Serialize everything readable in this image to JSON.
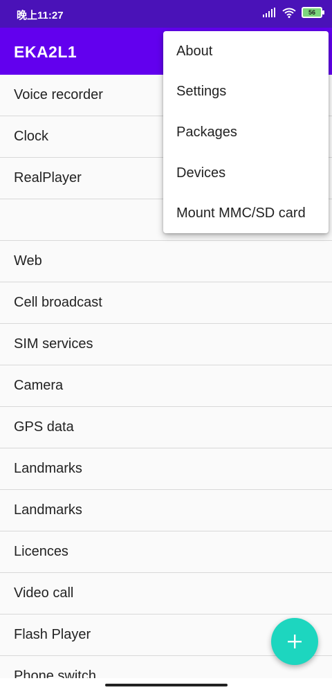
{
  "status_bar": {
    "time": "晚上11:27",
    "battery": "56"
  },
  "app_bar": {
    "title": "EKA2L1"
  },
  "apps": [
    "Voice recorder",
    "Clock",
    "RealPlayer",
    "",
    "Web",
    "Cell broadcast",
    "SIM services",
    "Camera",
    "GPS data",
    "Landmarks",
    "Landmarks",
    "Licences",
    "Video call",
    "Flash Player",
    "Phone switch"
  ],
  "menu": {
    "items": [
      "About",
      "Settings",
      "Packages",
      "Devices",
      "Mount MMC/SD card"
    ]
  },
  "fab": {
    "icon": "plus-icon",
    "color": "#1dd6bf"
  },
  "colors": {
    "status_bar": "#4a12b8",
    "app_bar": "#6200ee",
    "accent": "#1dd6bf"
  }
}
